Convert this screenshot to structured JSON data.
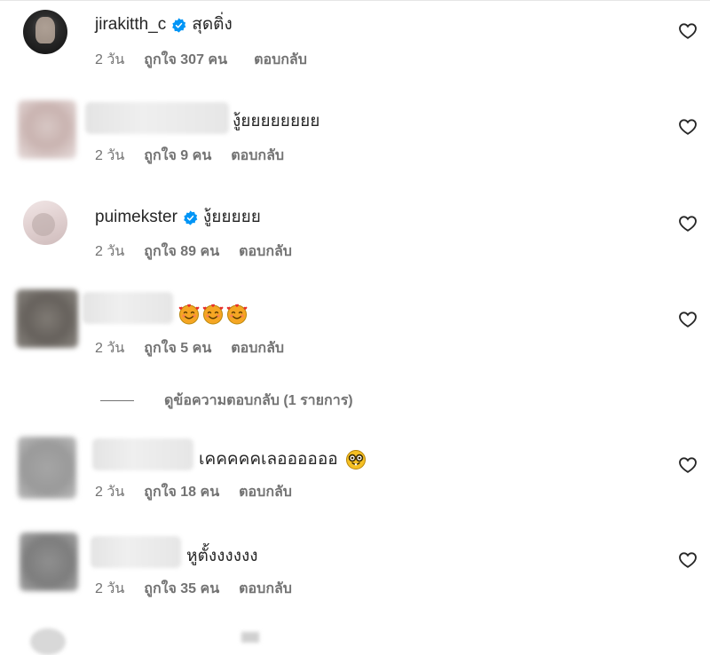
{
  "comments": [
    {
      "username": "jirakitth_c",
      "verified": true,
      "text": "สุดติ่ง",
      "time": "2 วัน",
      "likes": "ถูกใจ 307 คน",
      "reply": "ตอบกลับ",
      "avatar_icon": "profile-photo"
    },
    {
      "username": "",
      "verified": false,
      "text": "งู้ยยยยยยยย",
      "time": "2 วัน",
      "likes": "ถูกใจ 9 คน",
      "reply": "ตอบกลับ",
      "avatar_icon": "blurred-profile-photo"
    },
    {
      "username": "puimekster",
      "verified": true,
      "text": "งู้ยยยยย",
      "time": "2 วัน",
      "likes": "ถูกใจ 89 คน",
      "reply": "ตอบกลับ",
      "avatar_icon": "profile-photo"
    },
    {
      "username": "",
      "verified": false,
      "text": "",
      "emojis": [
        "smiling-face-with-hearts",
        "smiling-face-with-hearts",
        "smiling-face-with-hearts"
      ],
      "time": "2 วัน",
      "likes": "ถูกใจ 5 คน",
      "reply": "ตอบกลับ",
      "avatar_icon": "blurred-profile-photo"
    },
    {
      "username": "",
      "verified": false,
      "text": "เคคคคคเลออออออ",
      "emojis": [
        "nerd-face"
      ],
      "time": "2 วัน",
      "likes": "ถูกใจ 18 คน",
      "reply": "ตอบกลับ",
      "avatar_icon": "blurred-profile-photo"
    },
    {
      "username": "",
      "verified": false,
      "text": "หูตั้งงงงงง",
      "time": "2 วัน",
      "likes": "ถูกใจ 35 คน",
      "reply": "ตอบกลับ",
      "avatar_icon": "blurred-profile-photo"
    }
  ],
  "view_replies": "ดูข้อความตอบกลับ (1 รายการ)",
  "icons": {
    "like": "heart-outline-icon",
    "verified": "verified-badge-icon"
  },
  "colors": {
    "text_primary": "#262626",
    "text_secondary": "#737373",
    "verified_blue": "#0095f6",
    "background": "#ffffff"
  }
}
